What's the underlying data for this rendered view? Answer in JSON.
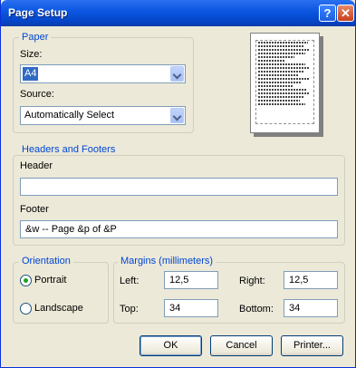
{
  "window": {
    "title": "Page Setup",
    "help_glyph": "?",
    "close_glyph": "✕"
  },
  "paper": {
    "legend": "Paper",
    "size_label": "Size:",
    "size_value": "A4",
    "source_label": "Source:",
    "source_value": "Automatically Select"
  },
  "headers_footers": {
    "legend": "Headers and Footers",
    "header_label": "Header",
    "header_value": "",
    "footer_label": "Footer",
    "footer_value": "&w  -- Page &p of &P"
  },
  "orientation": {
    "legend": "Orientation",
    "portrait_label": "Portrait",
    "landscape_label": "Landscape",
    "selected": "portrait"
  },
  "margins": {
    "legend": "Margins (millimeters)",
    "left_label": "Left:",
    "left_value": "12,5",
    "right_label": "Right:",
    "right_value": "12,5",
    "top_label": "Top:",
    "top_value": "34",
    "bottom_label": "Bottom:",
    "bottom_value": "34"
  },
  "buttons": {
    "ok": "OK",
    "cancel": "Cancel",
    "printer": "Printer..."
  },
  "colors": {
    "title_bar": "#0a55e0",
    "dialog_bg": "#ece9d8",
    "group_label": "#0046d5",
    "selection": "#316ac5"
  },
  "icons": [
    "help-icon",
    "close-icon",
    "dropdown-arrow-icon",
    "page-preview-icon"
  ]
}
